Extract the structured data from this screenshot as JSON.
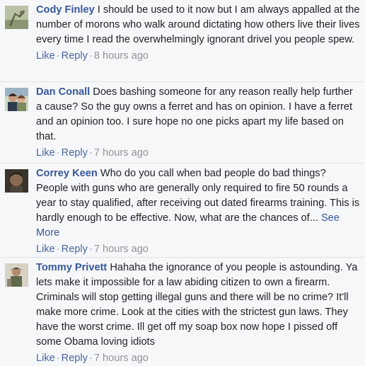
{
  "comments": [
    {
      "author": "Cody Finley",
      "text": "I should be used to it now but I am always appalled at the number of morons who walk around dictating how others live their lives every time I read the overwhelmingly ignorant drivel you people spew.",
      "see_more": "",
      "like": "Like",
      "reply": "Reply",
      "time": "8 hours ago"
    },
    {
      "author": "Dan Conall",
      "text": "Does bashing someone for any reason really help further a cause? So the guy owns a ferret and has on opinion. I have a ferret and an opinion too. I sure hope no one picks apart my life based on that.",
      "see_more": "",
      "like": "Like",
      "reply": "Reply",
      "time": "7 hours ago"
    },
    {
      "author": "Correy Keen",
      "text": "Who do you call when bad people do bad things? People with guns who are generally only required to fire 50 rounds a year to stay qualified, after receiving out dated firearms training. This is hardly enough to be effective. Now, what are the chances of...",
      "see_more": "See More",
      "like": "Like",
      "reply": "Reply",
      "time": "7 hours ago"
    },
    {
      "author": "Tommy Privett",
      "text": "Hahaha the ignorance of you people is astounding. Ya lets make it impossible for a law abiding citizen to own a firearm. Criminals will stop getting illegal guns and there will be no crime? It'll make more crime. Look at the cities with the strictest gun laws. They have the worst crime. Ill get off my soap box now hope I pissed off some Obama loving idiots",
      "see_more": "",
      "like": "Like",
      "reply": "Reply",
      "time": "7 hours ago"
    }
  ],
  "separator": "·"
}
